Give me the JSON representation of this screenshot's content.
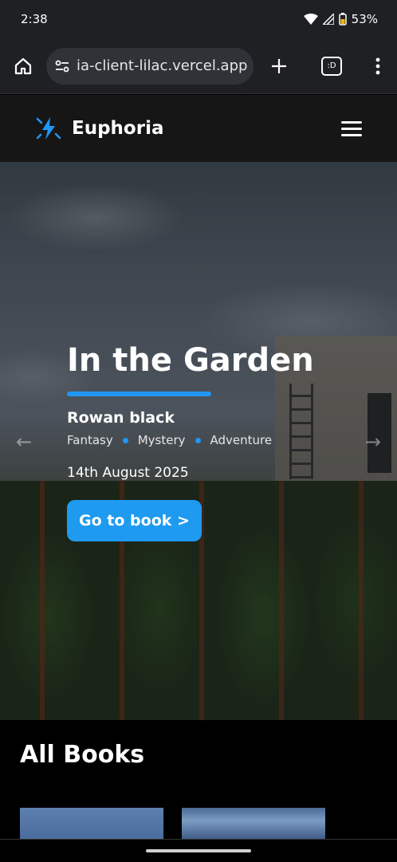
{
  "status_bar": {
    "time": "2:38",
    "battery": "53%"
  },
  "browser": {
    "url": "ia-client-lilac.vercel.app",
    "tab_count": ":D"
  },
  "site": {
    "brand_name": "Euphoria",
    "accent_color": "#2196f3"
  },
  "hero": {
    "title": "In the Garden",
    "author": "Rowan black",
    "genres": [
      "Fantasy",
      "Mystery",
      "Adventure"
    ],
    "date": "14th August 2025",
    "button_label": "Go to book >"
  },
  "books_section": {
    "title": "All Books"
  },
  "icons": {
    "home": "home-icon",
    "site_info": "tune-icon",
    "new_tab": "plus-icon",
    "menu": "more-vert-icon",
    "hamburger": "hamburger-icon",
    "logo": "lightning-logo-icon",
    "prev": "arrow-left-icon",
    "next": "arrow-right-icon"
  }
}
